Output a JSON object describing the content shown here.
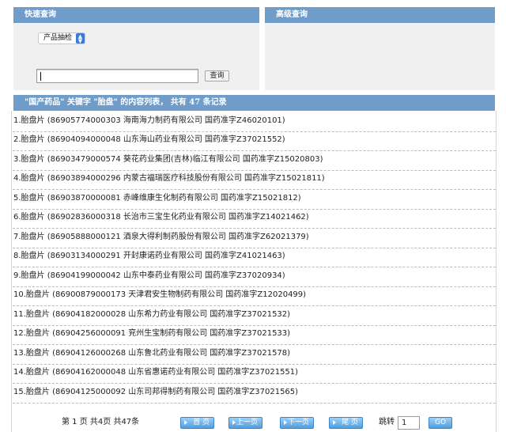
{
  "quick_search": {
    "title": "快速查询",
    "select_value": "产品抽检",
    "input_value": "",
    "button_label": "查询"
  },
  "advanced_search": {
    "title": "高级查询"
  },
  "results": {
    "header": "\"国产药品\" 关键字 \"胎盘\" 的内容列表， 共有 47 条记录",
    "rows": [
      "1.胎盘片 (86905774000303 海南海力制药有限公司 国药准字Z46020101)",
      "2.胎盘片 (86904094000048 山东海山药业有限公司 国药准字Z37021552)",
      "3.胎盘片 (86903479000574 葵花药业集团(吉林)临江有限公司 国药准字Z15020803)",
      "4.胎盘片 (86903894000296 内蒙古福瑞医疗科技股份有限公司 国药准字Z15021811)",
      "5.胎盘片 (86903870000081 赤峰维康生化制药有限公司 国药准字Z15021812)",
      "6.胎盘片 (86902836000318 长治市三宝生化药业有限公司 国药准字Z14021462)",
      "7.胎盘片 (86905888000121 酒泉大得利制药股份有限公司 国药准字Z62021379)",
      "8.胎盘片 (86903134000291 开封康诺药业有限公司 国药准字Z41021463)",
      "9.胎盘片 (86904199000042 山东中泰药业有限公司 国药准字Z37020934)",
      "10.胎盘片 (86900879000173 天津君安生物制药有限公司 国药准字Z12020499)",
      "11.胎盘片 (86904182000028 山东希力药业有限公司 国药准字Z37021532)",
      "12.胎盘片 (86904256000091 兖州生宝制药有限公司 国药准字Z37021533)",
      "13.胎盘片 (86904126000268 山东鲁北药业有限公司 国药准字Z37021578)",
      "14.胎盘片 (86904162000048 山东省惠诺药业有限公司 国药准字Z37021551)",
      "15.胎盘片 (86904125000092 山东司邦得制药有限公司 国药准字Z37021565)"
    ]
  },
  "pagination": {
    "info": "第 1 页 共4页 共47条",
    "first": "首 页",
    "prev": "上一页",
    "next": "下一页",
    "last": "尾 页",
    "jump_label": "跳转",
    "jump_value": "1",
    "go": "GO"
  }
}
